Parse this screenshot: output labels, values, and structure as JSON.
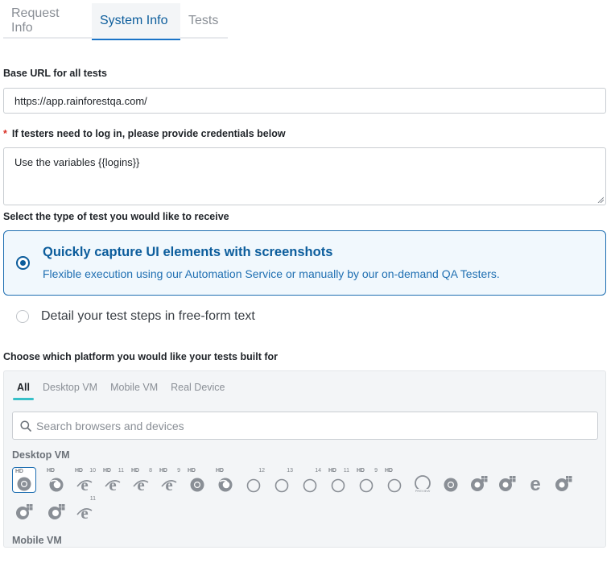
{
  "tabs": [
    {
      "label": "Request Info",
      "active": false
    },
    {
      "label": "System Info",
      "active": true
    },
    {
      "label": "Tests",
      "active": false
    }
  ],
  "base_url": {
    "label": "Base URL for all tests",
    "value": "https://app.rainforestqa.com/"
  },
  "credentials": {
    "required_marker": "*",
    "label": "If testers need to log in, please provide credentials below",
    "value": "Use the variables {{logins}}"
  },
  "test_type": {
    "label": "Select the type of test you would like to receive",
    "options": [
      {
        "title": "Quickly capture UI elements with screenshots",
        "description": "Flexible execution using our Automation Service or manually by our on-demand QA Testers.",
        "selected": true
      },
      {
        "title": "Detail your test steps in free-form text",
        "selected": false
      }
    ]
  },
  "platform": {
    "label": "Choose which platform you would like your tests built for",
    "tabs": [
      "All",
      "Desktop VM",
      "Mobile VM",
      "Real Device"
    ],
    "active_tab": "All",
    "search_placeholder": "Search browsers and devices",
    "sections": [
      "Desktop VM",
      "Mobile VM"
    ],
    "browser_icons": [
      {
        "name": "chrome-icon",
        "tag": "HD",
        "ver": "",
        "selected": true
      },
      {
        "name": "firefox-icon",
        "tag": "HD",
        "ver": ""
      },
      {
        "name": "ie-icon",
        "tag": "HD",
        "ver": "10"
      },
      {
        "name": "ie-icon",
        "tag": "HD",
        "ver": "11"
      },
      {
        "name": "ie-icon",
        "tag": "HD",
        "ver": "8"
      },
      {
        "name": "ie-icon",
        "tag": "HD",
        "ver": "9"
      },
      {
        "name": "chrome-icon",
        "tag": "HD",
        "ver": ""
      },
      {
        "name": "firefox-icon",
        "tag": "HD",
        "ver": ""
      },
      {
        "name": "safari-icon",
        "tag": "",
        "ver": "12"
      },
      {
        "name": "safari-icon",
        "tag": "",
        "ver": "13"
      },
      {
        "name": "safari-icon",
        "tag": "",
        "ver": "14"
      },
      {
        "name": "safari-icon",
        "tag": "HD",
        "ver": "11"
      },
      {
        "name": "safari-icon",
        "tag": "HD",
        "ver": "9"
      },
      {
        "name": "safari-icon",
        "tag": "HD",
        "ver": ""
      },
      {
        "name": "safari-preview-icon",
        "tag": "",
        "ver": ""
      },
      {
        "name": "chrome-icon",
        "tag": "",
        "ver": ""
      },
      {
        "name": "chrome-windows-icon",
        "tag": "",
        "ver": ""
      },
      {
        "name": "chrome-windows-icon",
        "tag": "",
        "ver": ""
      },
      {
        "name": "edge-icon",
        "tag": "",
        "ver": ""
      },
      {
        "name": "chrome-windows-icon",
        "tag": "",
        "ver": ""
      },
      {
        "name": "firefox-windows-icon",
        "tag": "",
        "ver": ""
      },
      {
        "name": "firefox-windows-icon",
        "tag": "",
        "ver": ""
      },
      {
        "name": "ie-icon",
        "tag": "",
        "ver": "11"
      }
    ]
  },
  "colors": {
    "accent": "#0c5d9c",
    "teal_underline": "#37c0c8",
    "required": "#d93025"
  }
}
